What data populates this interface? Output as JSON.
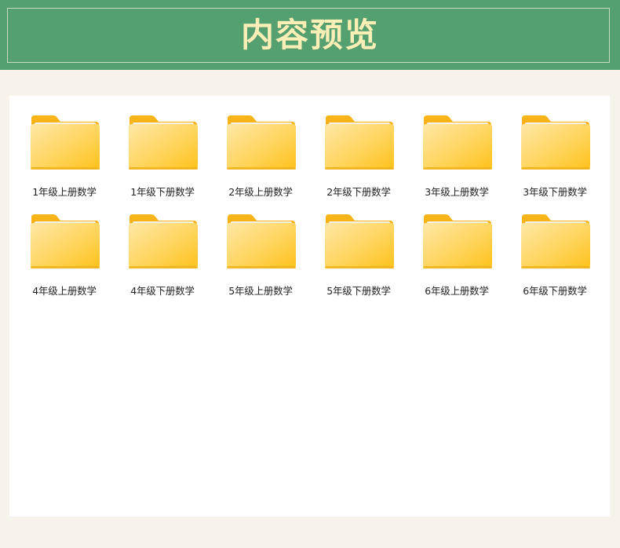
{
  "header": {
    "title": "内容预览"
  },
  "colors": {
    "header_bg": "#55a070",
    "title_text": "#fbefb8",
    "page_bg": "#f7f3eb",
    "panel_bg": "#ffffff",
    "folder_yellow": "#ffc928",
    "folder_tab": "#f7b81a"
  },
  "folders": [
    {
      "label": "1年级上册数学",
      "icon": "folder-icon"
    },
    {
      "label": "1年级下册数学",
      "icon": "folder-icon"
    },
    {
      "label": "2年级上册数学",
      "icon": "folder-icon"
    },
    {
      "label": "2年级下册数学",
      "icon": "folder-icon"
    },
    {
      "label": "3年级上册数学",
      "icon": "folder-icon"
    },
    {
      "label": "3年级下册数学",
      "icon": "folder-icon"
    },
    {
      "label": "4年级上册数学",
      "icon": "folder-icon"
    },
    {
      "label": "4年级下册数学",
      "icon": "folder-icon"
    },
    {
      "label": "5年级上册数学",
      "icon": "folder-icon"
    },
    {
      "label": "5年级下册数学",
      "icon": "folder-icon"
    },
    {
      "label": "6年级上册数学",
      "icon": "folder-icon"
    },
    {
      "label": "6年级下册数学",
      "icon": "folder-icon"
    }
  ]
}
